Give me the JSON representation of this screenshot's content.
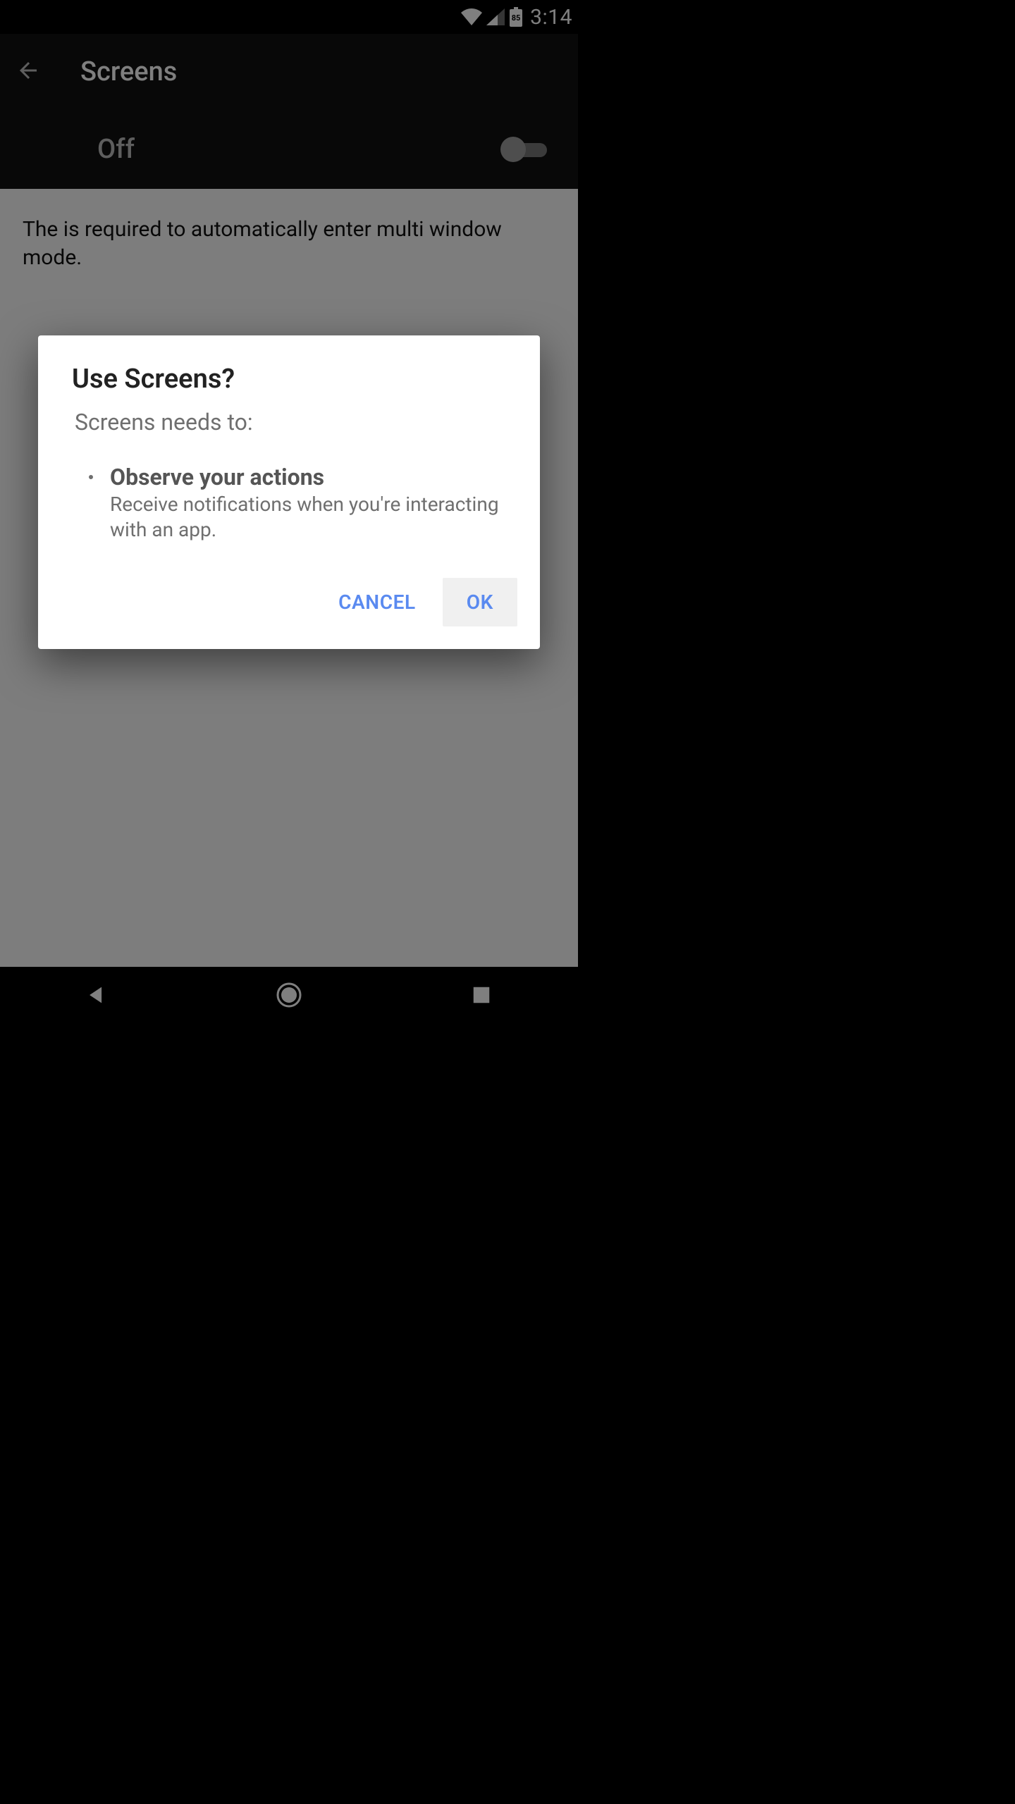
{
  "statusbar": {
    "battery_level": "85",
    "time": "3:14"
  },
  "appbar": {
    "title": "Screens"
  },
  "toggle": {
    "label": "Off",
    "on": false
  },
  "content": {
    "description": "The is required to automatically enter multi window mode."
  },
  "dialog": {
    "title": "Use Screens?",
    "subtitle": "Screens needs to:",
    "permissions": [
      {
        "heading": "Observe your actions",
        "body": "Receive notifications when you're interacting with an app."
      }
    ],
    "cancel_label": "CANCEL",
    "ok_label": "OK"
  }
}
